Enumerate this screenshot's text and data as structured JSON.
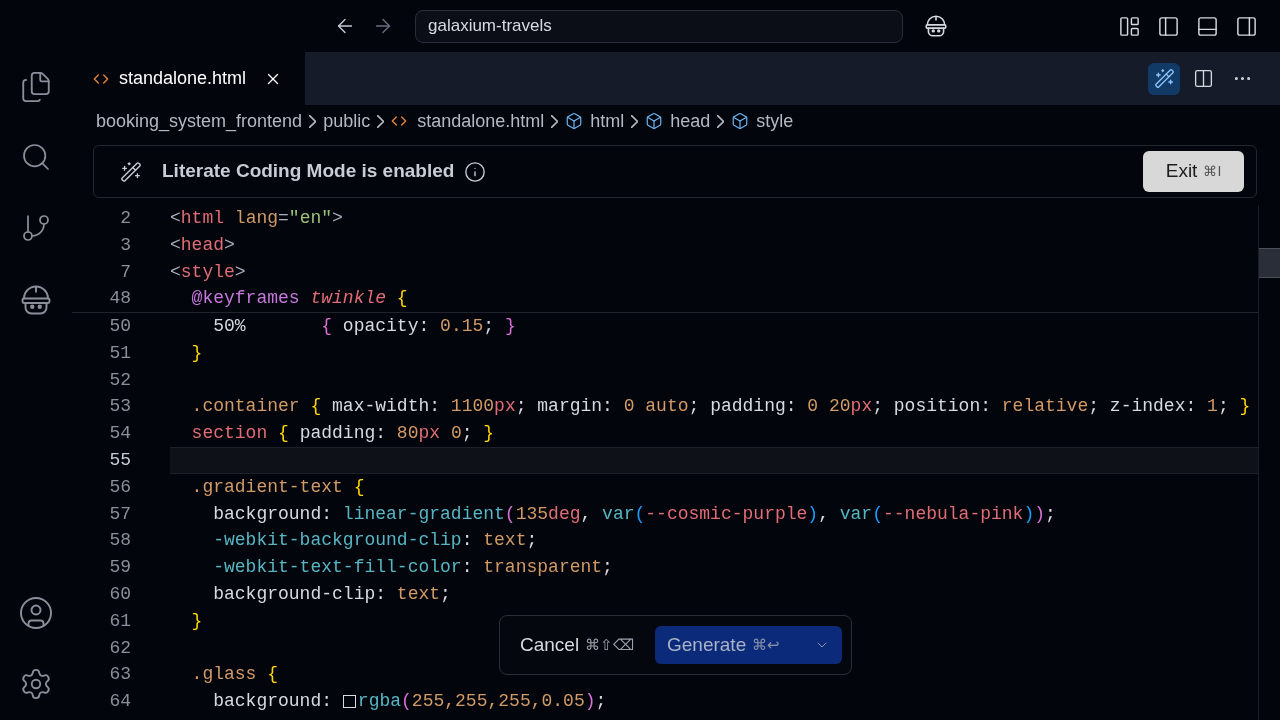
{
  "title_bar": {
    "search": {
      "value": "galaxium-travels"
    }
  },
  "tabs": [
    {
      "label": "standalone.html",
      "selected": true
    }
  ],
  "editor_actions": [
    {
      "kind": "wand",
      "on": true
    },
    {
      "kind": "split",
      "on": false
    },
    {
      "kind": "more",
      "on": false
    }
  ],
  "breadcrumbs": [
    {
      "label": "booking_system_frontend",
      "kind": "folder"
    },
    {
      "label": "public",
      "kind": "folder"
    },
    {
      "label": "standalone.html",
      "kind": "file"
    },
    {
      "label": "html",
      "kind": "symbol"
    },
    {
      "label": "head",
      "kind": "symbol"
    },
    {
      "label": "style",
      "kind": "symbol"
    }
  ],
  "banner": {
    "message": "Literate Coding Mode is enabled",
    "button": "Exit",
    "shortcut": "⌘I"
  },
  "editor": {
    "sticky_lines": [
      {
        "number": "2",
        "tokens": [
          {
            "kind": "punct",
            "text": "<"
          },
          {
            "kind": "tag",
            "text": "html"
          },
          {
            "kind": "attr",
            "text": " lang"
          },
          {
            "kind": "punct",
            "text": "="
          },
          {
            "kind": "string",
            "text": "\"en\""
          },
          {
            "kind": "punct",
            "text": ">"
          }
        ]
      },
      {
        "number": "3",
        "tokens": [
          {
            "kind": "punct",
            "text": "<"
          },
          {
            "kind": "tag",
            "text": "head"
          },
          {
            "kind": "punct",
            "text": ">"
          }
        ]
      },
      {
        "number": "7",
        "tokens": [
          {
            "kind": "punct",
            "text": "<"
          },
          {
            "kind": "tag",
            "text": "style"
          },
          {
            "kind": "punct",
            "text": ">"
          }
        ]
      },
      {
        "number": "48",
        "tokens": [
          {
            "kind": "keyword",
            "text": "  @keyframes"
          },
          {
            "kind": "italic",
            "text": " twinkle"
          },
          {
            "kind": "brace",
            "text": " {"
          }
        ]
      }
    ],
    "lines": [
      {
        "number": "50",
        "selected": false,
        "tokens": [
          {
            "kind": "plain",
            "text": "    50%       "
          },
          {
            "kind": "paren",
            "text": "{"
          },
          {
            "kind": "plain",
            "text": " opacity: "
          },
          {
            "kind": "number",
            "text": "0.15"
          },
          {
            "kind": "plain",
            "text": "; "
          },
          {
            "kind": "paren",
            "text": "}"
          }
        ]
      },
      {
        "number": "51",
        "selected": false,
        "tokens": [
          {
            "kind": "brace",
            "text": "  }"
          }
        ]
      },
      {
        "number": "52",
        "selected": false
      },
      {
        "number": "53",
        "selected": false,
        "tokens": [
          {
            "kind": "selector",
            "text": "  .container"
          },
          {
            "kind": "brace",
            "text": " {"
          },
          {
            "kind": "plain",
            "text": " max-width: "
          },
          {
            "kind": "number",
            "text": "1100"
          },
          {
            "kind": "unit",
            "text": "px"
          },
          {
            "kind": "plain",
            "text": "; margin: "
          },
          {
            "kind": "number",
            "text": "0 auto"
          },
          {
            "kind": "plain",
            "text": "; padding: "
          },
          {
            "kind": "number",
            "text": "0 20"
          },
          {
            "kind": "unit",
            "text": "px"
          },
          {
            "kind": "plain",
            "text": "; position: "
          },
          {
            "kind": "number",
            "text": "relative"
          },
          {
            "kind": "plain",
            "text": "; z-index: "
          },
          {
            "kind": "number",
            "text": "1"
          },
          {
            "kind": "plain",
            "text": "; "
          },
          {
            "kind": "brace",
            "text": "}"
          }
        ]
      },
      {
        "number": "54",
        "selected": false,
        "tokens": [
          {
            "kind": "tag",
            "text": "  section"
          },
          {
            "kind": "brace",
            "text": " {"
          },
          {
            "kind": "plain",
            "text": " padding: "
          },
          {
            "kind": "number",
            "text": "80"
          },
          {
            "kind": "unit",
            "text": "px"
          },
          {
            "kind": "number",
            "text": " 0"
          },
          {
            "kind": "plain",
            "text": "; "
          },
          {
            "kind": "brace",
            "text": "}"
          }
        ]
      },
      {
        "number": "55",
        "selected": true
      },
      {
        "number": "56",
        "selected": false,
        "tokens": [
          {
            "kind": "selector",
            "text": "  .gradient-text"
          },
          {
            "kind": "brace",
            "text": " {"
          }
        ]
      },
      {
        "number": "57",
        "selected": false,
        "tokens": [
          {
            "kind": "plain",
            "text": "    background: "
          },
          {
            "kind": "func",
            "text": "linear-gradient"
          },
          {
            "kind": "paren",
            "text": "("
          },
          {
            "kind": "number",
            "text": "135"
          },
          {
            "kind": "unit",
            "text": "deg"
          },
          {
            "kind": "plain",
            "text": ", "
          },
          {
            "kind": "func",
            "text": "var"
          },
          {
            "kind": "paren2",
            "text": "("
          },
          {
            "kind": "unit",
            "text": "--cosmic-purple"
          },
          {
            "kind": "paren2",
            "text": ")"
          },
          {
            "kind": "plain",
            "text": ", "
          },
          {
            "kind": "func",
            "text": "var"
          },
          {
            "kind": "paren2",
            "text": "("
          },
          {
            "kind": "unit",
            "text": "--nebula-pink"
          },
          {
            "kind": "paren2",
            "text": ")"
          },
          {
            "kind": "paren",
            "text": ")"
          },
          {
            "kind": "plain",
            "text": ";"
          }
        ]
      },
      {
        "number": "58",
        "selected": false,
        "tokens": [
          {
            "kind": "func",
            "text": "    -webkit-background-clip"
          },
          {
            "kind": "plain",
            "text": ": "
          },
          {
            "kind": "number",
            "text": "text"
          },
          {
            "kind": "plain",
            "text": ";"
          }
        ]
      },
      {
        "number": "59",
        "selected": false,
        "tokens": [
          {
            "kind": "func",
            "text": "    -webkit-text-fill-color"
          },
          {
            "kind": "plain",
            "text": ": "
          },
          {
            "kind": "number",
            "text": "transparent"
          },
          {
            "kind": "plain",
            "text": ";"
          }
        ]
      },
      {
        "number": "60",
        "selected": false,
        "tokens": [
          {
            "kind": "plain",
            "text": "    background-clip: "
          },
          {
            "kind": "number",
            "text": "text"
          },
          {
            "kind": "plain",
            "text": ";"
          }
        ]
      },
      {
        "number": "61",
        "selected": false,
        "tokens": [
          {
            "kind": "brace",
            "text": "  }"
          }
        ]
      },
      {
        "number": "62",
        "selected": false
      },
      {
        "number": "63",
        "selected": false,
        "tokens": [
          {
            "kind": "selector",
            "text": "  .glass"
          },
          {
            "kind": "brace",
            "text": " {"
          }
        ]
      },
      {
        "number": "64",
        "selected": false,
        "tokens": [
          {
            "kind": "plain",
            "text": "    background: "
          },
          {
            "kind": "swatch"
          },
          {
            "kind": "func",
            "text": "rgba"
          },
          {
            "kind": "paren",
            "text": "("
          },
          {
            "kind": "number",
            "text": "255,255,255,0.05"
          },
          {
            "kind": "paren",
            "text": ")"
          },
          {
            "kind": "plain",
            "text": ";"
          }
        ]
      }
    ]
  },
  "action_bar": {
    "cancel": "Cancel",
    "cancel_shortcut": "⌘⇧⌫",
    "generate": "Generate",
    "generate_shortcut": "⌘↩"
  }
}
